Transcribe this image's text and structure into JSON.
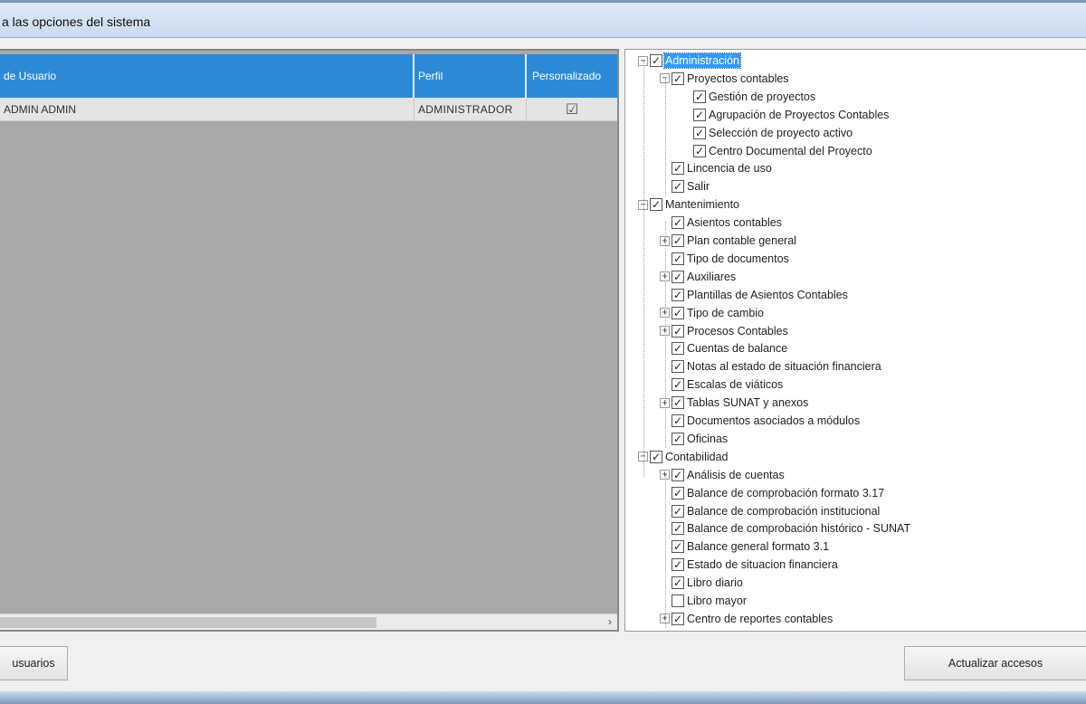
{
  "window": {
    "title": "a las opciones del sistema"
  },
  "grid": {
    "columns": [
      "de Usuario",
      "Perfil",
      "Personalizado"
    ],
    "rows": [
      {
        "user": "ADMIN ADMIN",
        "profile": "ADMINISTRADOR",
        "custom": "☑"
      }
    ],
    "scroll_right": "›"
  },
  "tree": {
    "items": [
      {
        "label": "Administración",
        "level": 0,
        "expander": "−",
        "checked": "✓",
        "selected": true
      },
      {
        "label": "Proyectos contables",
        "level": 1,
        "expander": "−",
        "checked": "✓"
      },
      {
        "label": "Gestión de proyectos",
        "level": 2,
        "expander": "",
        "checked": "✓"
      },
      {
        "label": "Agrupación de Proyectos Contables",
        "level": 2,
        "expander": "",
        "checked": "✓"
      },
      {
        "label": "Selección de proyecto activo",
        "level": 2,
        "expander": "",
        "checked": "✓"
      },
      {
        "label": "Centro Documental del Proyecto",
        "level": 2,
        "expander": "",
        "checked": "✓"
      },
      {
        "label": "Lincencia de uso",
        "level": 1,
        "expander": "",
        "checked": "✓"
      },
      {
        "label": "Salir",
        "level": 1,
        "expander": "",
        "checked": "✓"
      },
      {
        "label": "Mantenimiento",
        "level": 0,
        "expander": "−",
        "checked": "✓"
      },
      {
        "label": "Asientos contables",
        "level": 1,
        "expander": "",
        "checked": "✓"
      },
      {
        "label": "Plan contable general",
        "level": 1,
        "expander": "+",
        "checked": "✓"
      },
      {
        "label": "Tipo de documentos",
        "level": 1,
        "expander": "",
        "checked": "✓"
      },
      {
        "label": "Auxiliares",
        "level": 1,
        "expander": "+",
        "checked": "✓"
      },
      {
        "label": "Plantillas de Asientos Contables",
        "level": 1,
        "expander": "",
        "checked": "✓"
      },
      {
        "label": "Tipo de cambio",
        "level": 1,
        "expander": "+",
        "checked": "✓"
      },
      {
        "label": "Procesos Contables",
        "level": 1,
        "expander": "+",
        "checked": "✓"
      },
      {
        "label": "Cuentas de balance",
        "level": 1,
        "expander": "",
        "checked": "✓"
      },
      {
        "label": "Notas al estado de situación financiera",
        "level": 1,
        "expander": "",
        "checked": "✓"
      },
      {
        "label": "Escalas de viáticos",
        "level": 1,
        "expander": "",
        "checked": "✓"
      },
      {
        "label": "Tablas SUNAT y anexos",
        "level": 1,
        "expander": "+",
        "checked": "✓"
      },
      {
        "label": "Documentos asociados a módulos",
        "level": 1,
        "expander": "",
        "checked": "✓"
      },
      {
        "label": "Oficinas",
        "level": 1,
        "expander": "",
        "checked": "✓"
      },
      {
        "label": "Contabilidad",
        "level": 0,
        "expander": "−",
        "checked": "✓"
      },
      {
        "label": "Análisis de cuentas",
        "level": 1,
        "expander": "+",
        "checked": "✓"
      },
      {
        "label": "Balance de comprobación formato 3.17",
        "level": 1,
        "expander": "",
        "checked": "✓"
      },
      {
        "label": "Balance de comprobación institucional",
        "level": 1,
        "expander": "",
        "checked": "✓"
      },
      {
        "label": "Balance de comprobación histórico - SUNAT",
        "level": 1,
        "expander": "",
        "checked": "✓"
      },
      {
        "label": "Balance general formato 3.1",
        "level": 1,
        "expander": "",
        "checked": "✓"
      },
      {
        "label": "Estado de situacion financiera",
        "level": 1,
        "expander": "",
        "checked": "✓"
      },
      {
        "label": "Libro diario",
        "level": 1,
        "expander": "",
        "checked": "✓"
      },
      {
        "label": "Libro mayor",
        "level": 1,
        "expander": "",
        "checked": ""
      },
      {
        "label": "Centro de reportes contables",
        "level": 1,
        "expander": "+",
        "checked": "✓"
      }
    ]
  },
  "buttons": {
    "users_label": "usuarios",
    "update_label": "Actualizar accesos"
  }
}
